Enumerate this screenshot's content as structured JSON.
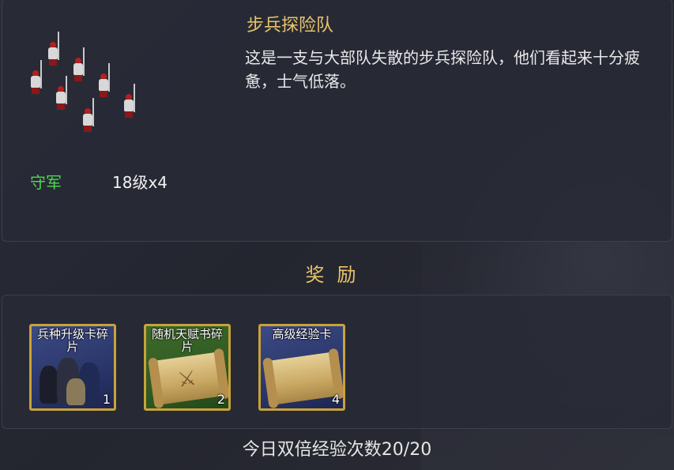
{
  "encounter": {
    "title": "步兵探险队",
    "description": "这是一支与大部队失散的步兵探险队，他们看起来十分疲惫，士气低落。",
    "guard_label": "守军",
    "guard_value": "18级x4"
  },
  "rewards": {
    "header": "奖励",
    "items": [
      {
        "name": "兵种升级卡碎片",
        "count": "1",
        "icon": "soldiers-art-icon"
      },
      {
        "name": "随机天赋书碎片",
        "count": "2",
        "icon": "scroll-swords-icon"
      },
      {
        "name": "高级经验卡",
        "count": "4",
        "icon": "map-scroll-icon"
      }
    ]
  },
  "footer": {
    "double_exp": "今日双倍经验次数20/20"
  },
  "colors": {
    "title": "#e8c46a",
    "guard": "#4cd94c",
    "card_border": "#c9a23a"
  }
}
